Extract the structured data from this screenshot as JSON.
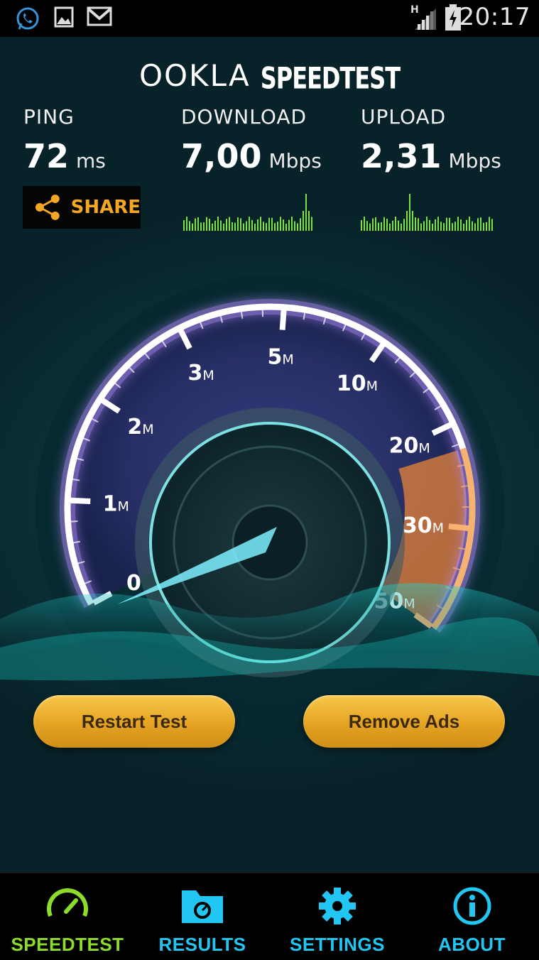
{
  "status_bar": {
    "time": "20:17",
    "network_type": "H",
    "icons": [
      "whatsapp-icon",
      "gallery-icon",
      "gmail-icon",
      "signal-icon",
      "battery-charging-icon"
    ]
  },
  "header": {
    "brand": "OOKLA",
    "app_name": "SPEEDTEST"
  },
  "results": {
    "ping": {
      "label": "PING",
      "value": "72",
      "unit": "ms"
    },
    "download": {
      "label": "DOWNLOAD",
      "value": "7,00",
      "unit": "Mbps"
    },
    "upload": {
      "label": "UPLOAD",
      "value": "2,31",
      "unit": "Mbps"
    }
  },
  "share_button": {
    "label": "SHARE",
    "icon": "share-icon"
  },
  "gauge": {
    "scale": [
      {
        "value": 0,
        "label": "0",
        "unit": ""
      },
      {
        "value": 1,
        "label": "1",
        "unit": "M"
      },
      {
        "value": 2,
        "label": "2",
        "unit": "M"
      },
      {
        "value": 3,
        "label": "3",
        "unit": "M"
      },
      {
        "value": 5,
        "label": "5",
        "unit": "M"
      },
      {
        "value": 10,
        "label": "10",
        "unit": "M"
      },
      {
        "value": 20,
        "label": "20",
        "unit": "M"
      },
      {
        "value": 30,
        "label": "30",
        "unit": "M"
      },
      {
        "value": 50,
        "label": "50",
        "unit": "M"
      }
    ],
    "needle_value": 0,
    "colors": {
      "ring": "#ffffff",
      "glow": "#b48cff",
      "high_zone": "#e8843a",
      "needle": "#7ff0ff"
    }
  },
  "buttons": {
    "restart": "Restart Test",
    "remove_ads": "Remove Ads"
  },
  "nav": {
    "items": [
      {
        "label": "SPEEDTEST",
        "icon": "speedometer-icon",
        "color": "#8edc2a",
        "active": true
      },
      {
        "label": "RESULTS",
        "icon": "results-folder-icon",
        "color": "#21c6f3",
        "active": false
      },
      {
        "label": "SETTINGS",
        "icon": "gear-icon",
        "color": "#21c6f3",
        "active": false
      },
      {
        "label": "ABOUT",
        "icon": "info-icon",
        "color": "#21c6f3",
        "active": false
      }
    ]
  },
  "colors": {
    "accent": "#f5a623",
    "nav_active": "#8edc2a",
    "nav_inactive": "#21c6f3",
    "sparkline": "#7ee04a"
  }
}
